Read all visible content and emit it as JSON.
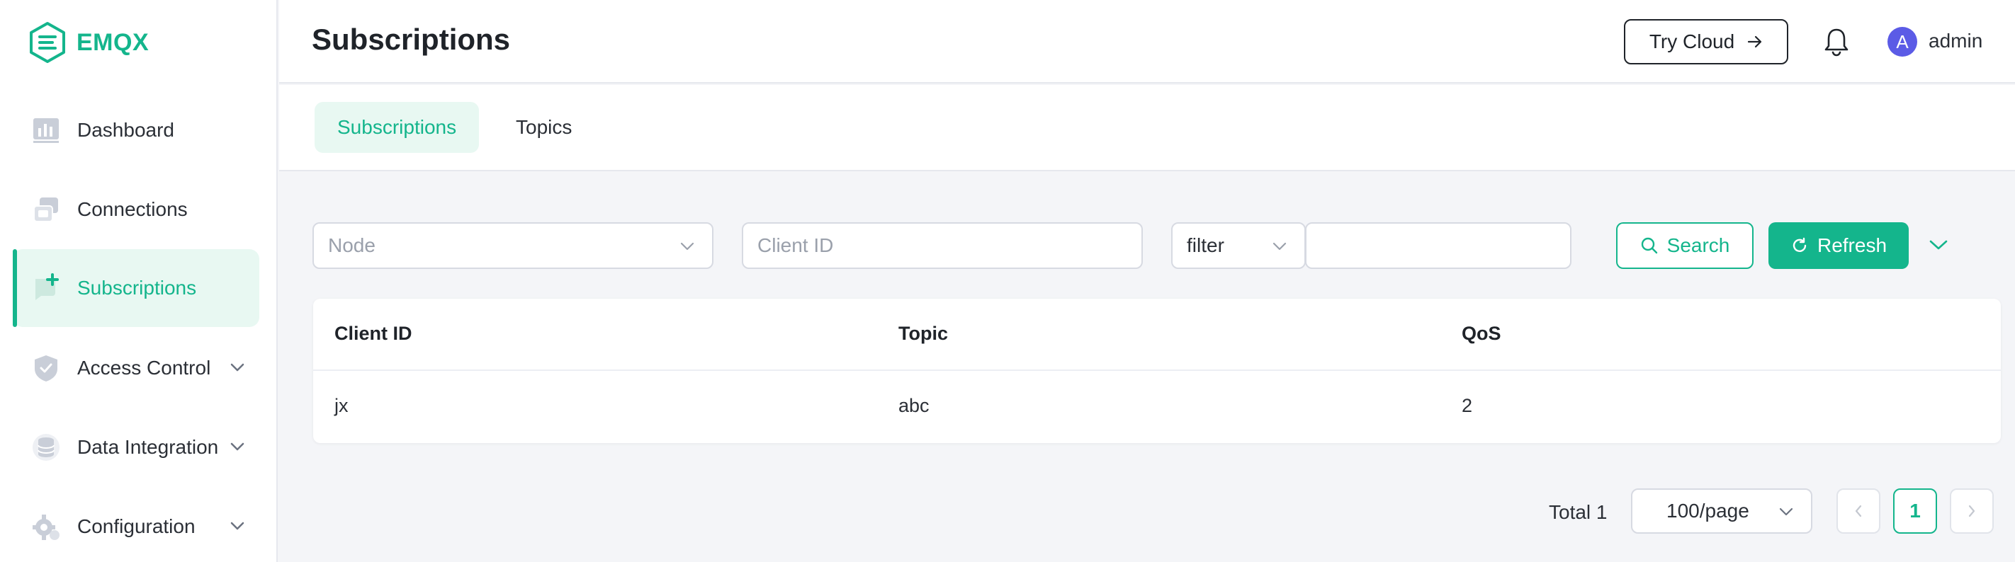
{
  "app": {
    "brand": "EMQX"
  },
  "sidebar": {
    "items": [
      {
        "label": "Dashboard",
        "icon": "dashboard-icon"
      },
      {
        "label": "Connections",
        "icon": "connections-icon"
      },
      {
        "label": "Subscriptions",
        "icon": "subscriptions-icon",
        "active": true
      },
      {
        "label": "Access Control",
        "icon": "shield-icon",
        "expandable": true
      },
      {
        "label": "Data Integration",
        "icon": "database-icon",
        "expandable": true
      },
      {
        "label": "Configuration",
        "icon": "gear-icon",
        "expandable": true
      }
    ]
  },
  "header": {
    "title": "Subscriptions",
    "try_cloud": "Try Cloud",
    "avatar_initial": "A",
    "username": "admin"
  },
  "tabs": [
    {
      "label": "Subscriptions",
      "active": true
    },
    {
      "label": "Topics",
      "active": false
    }
  ],
  "filters": {
    "node_placeholder": "Node",
    "client_id_placeholder": "Client ID",
    "filter_select": "filter",
    "filter_value": "",
    "search_label": "Search",
    "refresh_label": "Refresh"
  },
  "table": {
    "columns": [
      "Client ID",
      "Topic",
      "QoS"
    ],
    "rows": [
      [
        "jx",
        "abc",
        "2"
      ]
    ]
  },
  "pagination": {
    "total": "Total 1",
    "page_size": "100/page",
    "current_page": "1"
  },
  "colors": {
    "accent": "#14b58c",
    "accent_bg": "#e8f8f2",
    "avatar": "#5b5be6"
  }
}
